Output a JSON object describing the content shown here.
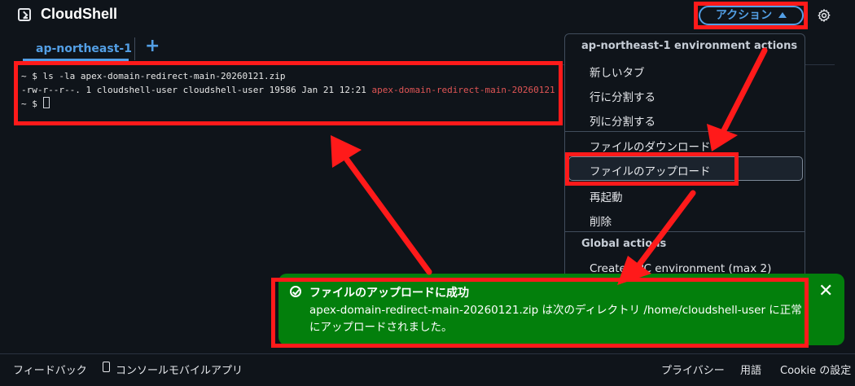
{
  "header": {
    "title": "CloudShell",
    "actions_label": "アクション"
  },
  "tabs": {
    "active": "ap-northeast-1",
    "add": "+"
  },
  "terminal": {
    "line1": "~ $ ls -la apex-domain-redirect-main-20260121.zip",
    "line2_prefix": "-rw-r--r--. 1 cloudshell-user cloudshell-user 19586 Jan 21 12:21 ",
    "line2_file": "apex-domain-redirect-main-20260121",
    "line3": "~ $ "
  },
  "menu": {
    "env_header": "ap-northeast-1 environment actions",
    "items": [
      "新しいタブ",
      "行に分割する",
      "列に分割する",
      "ファイルのダウンロード",
      "ファイルのアップロード",
      "再起動",
      "削除"
    ],
    "global_header": "Global actions",
    "global_item": "Create VPC environment (max 2)"
  },
  "flash": {
    "title": "ファイルのアップロードに成功",
    "body": "apex-domain-redirect-main-20260121.zip は次のディレクトリ /home/cloudshell-user に正常にアップロードされました。"
  },
  "footer": {
    "feedback": "フィードバック",
    "mobile_app": "コンソールモバイルアプリ",
    "privacy": "プライバシー",
    "terms": "用語",
    "cookie": "Cookie の設定"
  },
  "colors": {
    "background": "#0f141a",
    "accent": "#539fe5",
    "success": "#037f0c",
    "annotation": "#ff1a1a"
  },
  "icons": [
    "cloudshell-icon",
    "caret-up-icon",
    "gear-icon",
    "add-icon",
    "check-circle-icon",
    "close-icon",
    "mobile-icon"
  ]
}
